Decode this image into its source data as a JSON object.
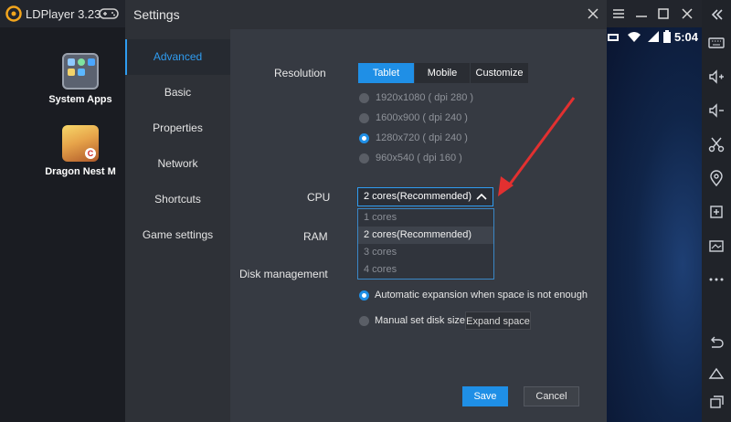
{
  "app": {
    "title": "LDPlayer 3.23"
  },
  "status_bar": {
    "time": "5:04"
  },
  "desktop": {
    "icons": [
      {
        "label": "System Apps",
        "icon": "system-apps-icon"
      },
      {
        "label": "Dragon Nest M",
        "icon": "dragon-nest-m-icon"
      }
    ]
  },
  "right_toolbar": {
    "icons": [
      "keyboard-icon",
      "volume-up-icon",
      "volume-down-icon",
      "scissors-icon",
      "location-icon",
      "add-apk-icon",
      "screenshot-icon",
      "more-icon",
      "back-icon",
      "home-icon",
      "recent-apps-icon"
    ]
  },
  "settings": {
    "title": "Settings",
    "nav": {
      "advanced": "Advanced",
      "basic": "Basic",
      "properties": "Properties",
      "network": "Network",
      "shortcuts": "Shortcuts",
      "game_settings": "Game settings"
    },
    "resolution": {
      "label": "Resolution",
      "tabs": [
        "Tablet",
        "Mobile",
        "Customize"
      ],
      "active_tab": "Tablet",
      "options": [
        "1920x1080 ( dpi 280 )",
        "1600x900 ( dpi 240 )",
        "1280x720 ( dpi 240 )",
        "960x540 ( dpi 160 )"
      ],
      "selected": "1280x720 ( dpi 240 )"
    },
    "cpu": {
      "label": "CPU",
      "value": "2 cores(Recommended)",
      "options": [
        "1 cores",
        "2 cores(Recommended)",
        "3 cores",
        "4 cores"
      ]
    },
    "ram": {
      "label": "RAM"
    },
    "disk": {
      "label": "Disk management",
      "auto_expansion": "Automatic expansion when space is not enough",
      "manual": "Manual set disk size",
      "expand_button": "Expand space",
      "selected": "Automatic expansion when space is not enough"
    },
    "buttons": {
      "save": "Save",
      "cancel": "Cancel"
    }
  },
  "colors": {
    "accent": "#1f8fe6",
    "annotation_arrow": "#e23030",
    "dialog_bg": "#363a42"
  }
}
